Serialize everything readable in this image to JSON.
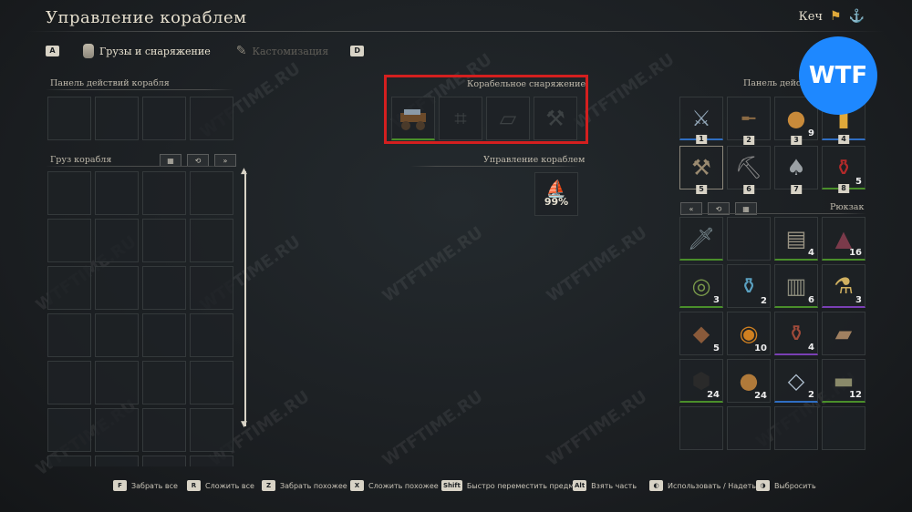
{
  "header": {
    "title": "Управление кораблем",
    "ship_name": "Кеч",
    "flag_icon": "flag-icon",
    "anchor_icon": "anchor-icon"
  },
  "tabs": {
    "key_left": "A",
    "key_right": "D",
    "items": [
      {
        "label": "Грузы и снаряжение",
        "active": true
      },
      {
        "label": "Кастомизация",
        "active": false
      }
    ]
  },
  "ship_actions_left": {
    "label": "Панель действий корабля"
  },
  "cargo": {
    "label": "Груз корабля",
    "buttons": [
      "▦",
      "⟲",
      "»"
    ]
  },
  "ship_equipment": {
    "label": "Корабельное снаряжение",
    "highlight_color": "#d41f1f"
  },
  "ship_control": {
    "label": "Управление кораблем",
    "value": "99%"
  },
  "actions_right": {
    "label": "Панель действий",
    "slots": [
      {
        "num": "1",
        "icon": "halberd",
        "count": ""
      },
      {
        "num": "2",
        "icon": "musket",
        "count": ""
      },
      {
        "num": "3",
        "icon": "bread",
        "count": "9"
      },
      {
        "num": "4",
        "icon": "lantern",
        "count": ""
      },
      {
        "num": "5",
        "icon": "axe",
        "count": ""
      },
      {
        "num": "6",
        "icon": "pickaxe",
        "count": ""
      },
      {
        "num": "7",
        "icon": "shovel",
        "count": ""
      },
      {
        "num": "8",
        "icon": "potion",
        "count": "5"
      }
    ]
  },
  "backpack": {
    "label": "Рюкзак",
    "buttons": [
      "«",
      "⟲",
      "▦"
    ],
    "slots": [
      {
        "icon": "sword",
        "count": ""
      },
      {
        "icon": "empty",
        "count": ""
      },
      {
        "icon": "cloth",
        "count": "4"
      },
      {
        "icon": "ore",
        "count": "16"
      },
      {
        "icon": "rope",
        "count": "3"
      },
      {
        "icon": "potion",
        "count": "2"
      },
      {
        "icon": "cloth",
        "count": "6"
      },
      {
        "icon": "vial",
        "count": "3"
      },
      {
        "icon": "leather",
        "count": "5"
      },
      {
        "icon": "stew",
        "count": "10"
      },
      {
        "icon": "flask",
        "count": "4"
      },
      {
        "icon": "ingot",
        "count": ""
      },
      {
        "icon": "coal",
        "count": "24"
      },
      {
        "icon": "gourd",
        "count": "24"
      },
      {
        "icon": "crystal",
        "count": "2"
      },
      {
        "icon": "wood",
        "count": "12"
      }
    ]
  },
  "footer": {
    "hints": [
      {
        "key": "F",
        "label": "Забрать все"
      },
      {
        "key": "R",
        "label": "Сложить все"
      },
      {
        "key": "Z",
        "label": "Забрать похожее"
      },
      {
        "key": "X",
        "label": "Сложить похожее"
      },
      {
        "key": "Shift",
        "label": "Быстро переместить предмет"
      },
      {
        "key": "Alt",
        "label": "Взять часть"
      },
      {
        "key": "◐",
        "label": "Использовать / Надеть"
      },
      {
        "key": "◑",
        "label": "Выбросить"
      }
    ]
  },
  "badge": {
    "text": "WTF"
  },
  "watermark": "WTFTIME.RU"
}
